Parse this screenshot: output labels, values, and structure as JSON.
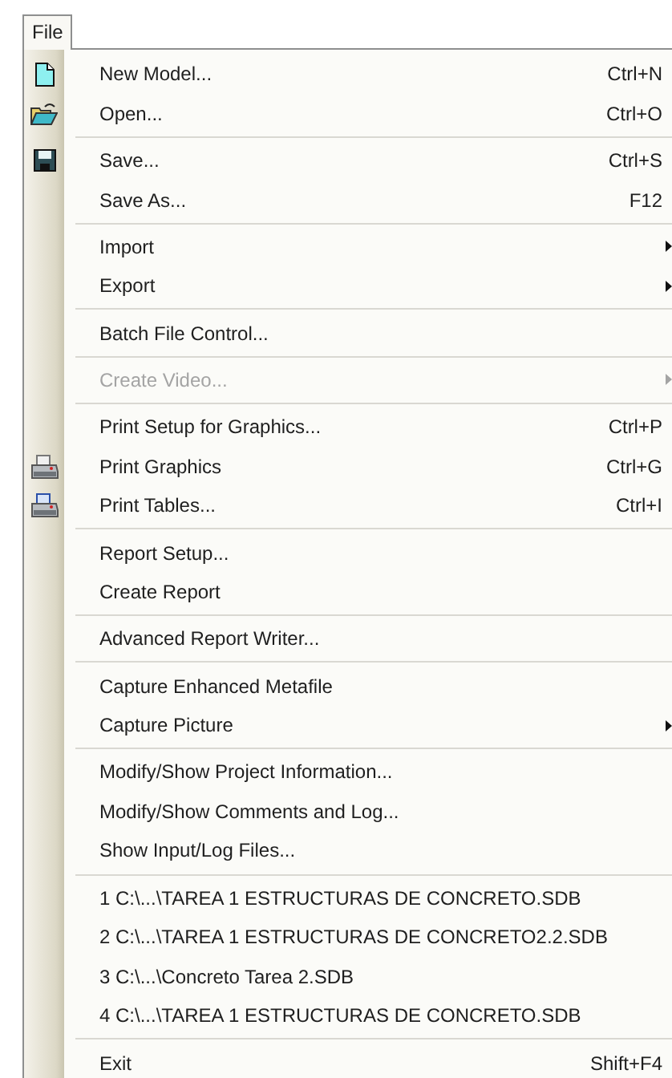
{
  "menu_bar": [
    {
      "label": "File",
      "selected": true
    }
  ],
  "menu": [
    {
      "kind": "item",
      "label": "New Model...",
      "shortcut": "Ctrl+N",
      "disabled": false
    },
    {
      "kind": "item",
      "label": "Open...",
      "shortcut": "Ctrl+O",
      "disabled": false
    },
    {
      "kind": "separator"
    },
    {
      "kind": "item",
      "label": "Save...",
      "shortcut": "Ctrl+S",
      "disabled": false
    },
    {
      "kind": "item",
      "label": "Save As...",
      "shortcut": "F12",
      "disabled": false
    },
    {
      "kind": "separator"
    },
    {
      "kind": "submenu",
      "label": "Import",
      "disabled": false
    },
    {
      "kind": "submenu",
      "label": "Export",
      "disabled": false
    },
    {
      "kind": "separator"
    },
    {
      "kind": "item",
      "label": "Batch File Control...",
      "disabled": false
    },
    {
      "kind": "separator"
    },
    {
      "kind": "submenu",
      "label": "Create Video...",
      "disabled": true
    },
    {
      "kind": "separator"
    },
    {
      "kind": "item",
      "label": "Print Setup for Graphics...",
      "shortcut": "Ctrl+P",
      "disabled": false
    },
    {
      "kind": "item",
      "label": "Print Graphics",
      "shortcut": "Ctrl+G",
      "disabled": false
    },
    {
      "kind": "item",
      "label": "Print Tables...",
      "shortcut": "Ctrl+I",
      "disabled": false
    },
    {
      "kind": "separator"
    },
    {
      "kind": "item",
      "label": "Report Setup...",
      "disabled": false
    },
    {
      "kind": "item",
      "label": "Create Report",
      "disabled": false
    },
    {
      "kind": "separator"
    },
    {
      "kind": "item",
      "label": "Advanced Report Writer...",
      "disabled": false
    },
    {
      "kind": "separator"
    },
    {
      "kind": "item",
      "label": "Capture Enhanced Metafile",
      "disabled": false
    },
    {
      "kind": "submenu",
      "label": "Capture Picture",
      "disabled": false
    },
    {
      "kind": "separator"
    },
    {
      "kind": "item",
      "label": "Modify/Show Project Information...",
      "disabled": false
    },
    {
      "kind": "item",
      "label": "Modify/Show Comments and Log...",
      "disabled": false
    },
    {
      "kind": "item",
      "label": "Show Input/Log Files...",
      "disabled": false
    },
    {
      "kind": "separator"
    },
    {
      "kind": "item",
      "label": "1 C:\\...\\TAREA 1 ESTRUCTURAS DE CONCRETO.SDB",
      "disabled": false
    },
    {
      "kind": "item",
      "label": "2 C:\\...\\TAREA 1 ESTRUCTURAS DE CONCRETO2.2.SDB",
      "disabled": false
    },
    {
      "kind": "item",
      "label": "3 C:\\...\\Concreto Tarea 2.SDB",
      "disabled": false
    },
    {
      "kind": "item",
      "label": "4 C:\\...\\TAREA 1 ESTRUCTURAS DE CONCRETO.SDB",
      "disabled": false
    },
    {
      "kind": "separator"
    },
    {
      "kind": "item",
      "label": "Exit",
      "shortcut": "Shift+F4",
      "disabled": false
    }
  ]
}
